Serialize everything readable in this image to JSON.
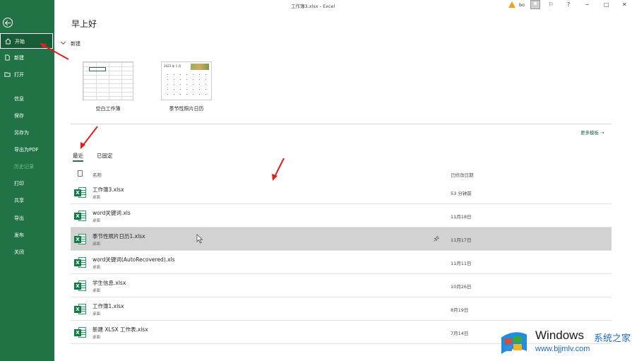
{
  "window": {
    "title": "工作簿3.xlsx  -  Excel",
    "user": "bo",
    "help_glyph": "?",
    "minimize_glyph": "─",
    "maximize_glyph": "□",
    "close_glyph": "✕"
  },
  "sidebar": {
    "items": [
      {
        "label": "开始",
        "icon": "home-icon"
      },
      {
        "label": "新建",
        "icon": "new-document-icon"
      },
      {
        "label": "打开",
        "icon": "open-folder-icon"
      },
      {
        "label": "信息"
      },
      {
        "label": "保存"
      },
      {
        "label": "另存为"
      },
      {
        "label": "导出为PDF"
      },
      {
        "label": "历史记录"
      },
      {
        "label": "打印"
      },
      {
        "label": "共享"
      },
      {
        "label": "导出"
      },
      {
        "label": "发布"
      },
      {
        "label": "关闭"
      }
    ]
  },
  "main": {
    "greeting": "早上好",
    "new_section": "新建",
    "templates": [
      {
        "label": "空白工作簿"
      },
      {
        "label": "季节性照片日历",
        "calendar_title": "2023 年 1 月"
      }
    ],
    "more_templates": "更多模板 →",
    "tabs": [
      "最近",
      "已固定"
    ],
    "columns": {
      "name": "名称",
      "date": "已修改日期"
    },
    "files": [
      {
        "name": "工作簿3.xlsx",
        "location": "桌面",
        "date": "53 分钟前"
      },
      {
        "name": "word关键词.xls",
        "location": "桌面",
        "date": "11月18日"
      },
      {
        "name": "季节性照片日历1.xlsx",
        "location": "桌面",
        "date": "11月17日",
        "selected": true
      },
      {
        "name": "word关键词(AutoRecovered).xls",
        "location": "桌面",
        "date": "11月11日"
      },
      {
        "name": "学生信息.xlsx",
        "location": "桌面",
        "date": "10月26日"
      },
      {
        "name": "工作簿1.xlsx",
        "location": "桌面",
        "date": "8月19日"
      },
      {
        "name": "新建 XLSX 工作表.xlsx",
        "location": "桌面",
        "date": "7月14日"
      }
    ],
    "excel_badge": "X"
  },
  "watermark": {
    "brand": "Windows",
    "cn": "系统之家",
    "url": "www.bjjmlv.com"
  },
  "colors": {
    "sidebar_bg": "#217346",
    "accent": "#217346",
    "selected_row": "#d2d2d2",
    "annotation_arrow": "#e02020"
  }
}
